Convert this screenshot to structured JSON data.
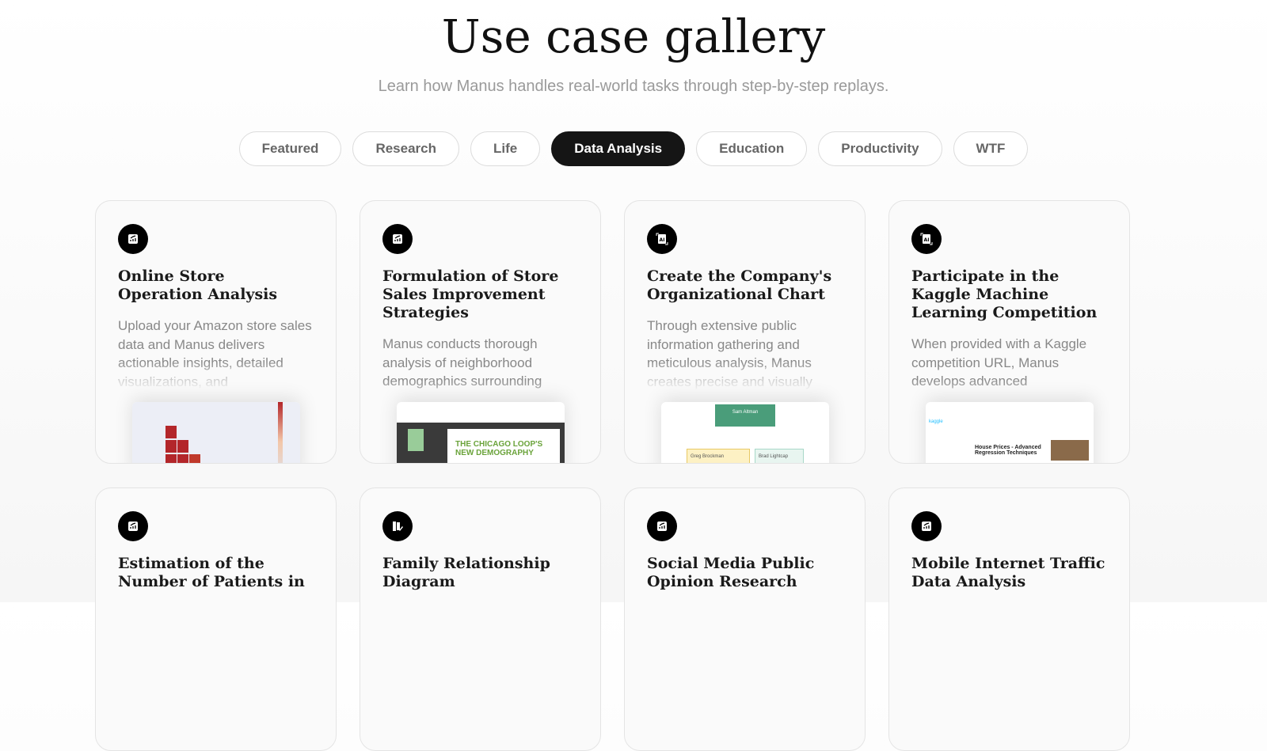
{
  "header": {
    "title": "Use case gallery",
    "subtitle": "Learn how Manus handles real-world tasks through step-by-step replays."
  },
  "tabs": [
    {
      "label": "Featured"
    },
    {
      "label": "Research"
    },
    {
      "label": "Life"
    },
    {
      "label": "Data Analysis",
      "active": true
    },
    {
      "label": "Education"
    },
    {
      "label": "Productivity"
    },
    {
      "label": "WTF"
    }
  ],
  "cards": [
    {
      "icon": "chart-icon",
      "title": "Online Store Operation Analysis",
      "description": "Upload your Amazon store sales data and Manus delivers actionable insights, detailed visualizations, and",
      "preview": "heatmap"
    },
    {
      "icon": "chart-icon",
      "title": "Formulation of Store Sales Improvement Strategies",
      "description": "Manus conducts thorough analysis of neighborhood demographics surrounding",
      "preview": "pdf",
      "preview_text": "THE CHICAGO LOOP'S NEW DEMOGRAPHY"
    },
    {
      "icon": "ai-icon",
      "title": "Create the Company's Organizational Chart",
      "description": "Through extensive public information gathering and meticulous analysis, Manus creates precise and visually",
      "preview": "org",
      "preview_text": [
        "Sam Altman",
        "Greg Brockman",
        "Brad Lightcap"
      ]
    },
    {
      "icon": "ai-icon",
      "title": "Participate in the Kaggle Machine Learning Competition",
      "description": "When provided with a Kaggle competition URL, Manus develops advanced",
      "preview": "kaggle",
      "preview_text": [
        "kaggle",
        "House Prices - Advanced Regression Techniques"
      ]
    },
    {
      "icon": "chart-icon",
      "title": "Estimation of the Number of Patients in",
      "description": ""
    },
    {
      "icon": "map-icon",
      "title": "Family Relationship Diagram",
      "description": ""
    },
    {
      "icon": "chart-icon",
      "title": "Social Media Public Opinion Research",
      "description": ""
    },
    {
      "icon": "chart-icon",
      "title": "Mobile Internet Traffic Data Analysis",
      "description": ""
    }
  ]
}
